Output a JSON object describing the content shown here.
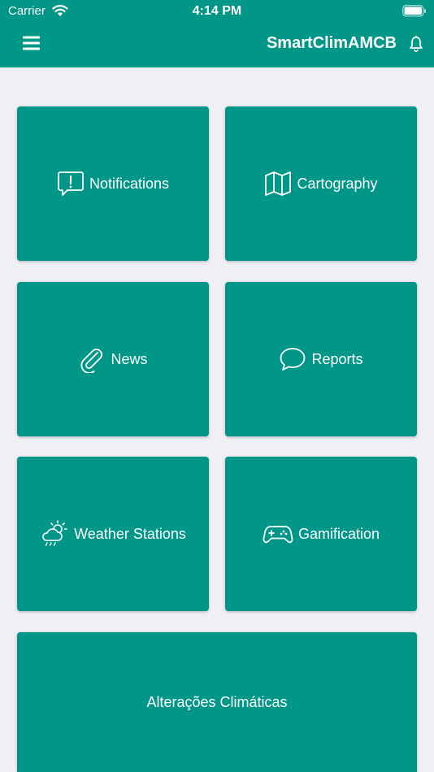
{
  "status_bar": {
    "carrier": "Carrier",
    "time": "4:14 PM"
  },
  "header": {
    "title": "SmartClimAMCB"
  },
  "tiles": [
    {
      "label": "Notifications",
      "icon": "message-alert-icon"
    },
    {
      "label": "Cartography",
      "icon": "map-icon"
    },
    {
      "label": "News",
      "icon": "paperclip-icon"
    },
    {
      "label": "Reports",
      "icon": "chat-bubble-icon"
    },
    {
      "label": "Weather Stations",
      "icon": "weather-rain-sun-icon"
    },
    {
      "label": "Gamification",
      "icon": "gamepad-icon"
    },
    {
      "label": "Alterações Climáticas",
      "icon": ""
    }
  ],
  "colors": {
    "primary": "#009688",
    "background": "#efeff4",
    "text_on_primary": "#ffffff"
  }
}
